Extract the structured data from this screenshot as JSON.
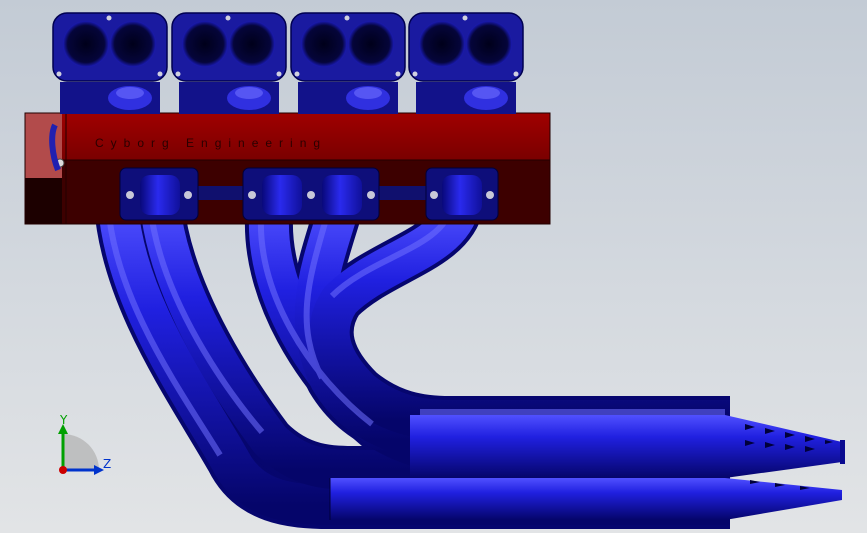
{
  "model": {
    "engraving": "Cyborg Engineering",
    "colors": {
      "manifold_body": "#8b0000",
      "manifold_dark": "#3d0000",
      "pipes": "#1a1ad6",
      "pipe_highlight": "#6a6aff",
      "pipe_shadow": "#00005a",
      "throttle_body": "#14148c"
    }
  },
  "triad": {
    "y_label": "Y",
    "z_label": "Z",
    "colors": {
      "y": "#00a000",
      "z": "#0033cc",
      "x": "#cc0000"
    }
  }
}
